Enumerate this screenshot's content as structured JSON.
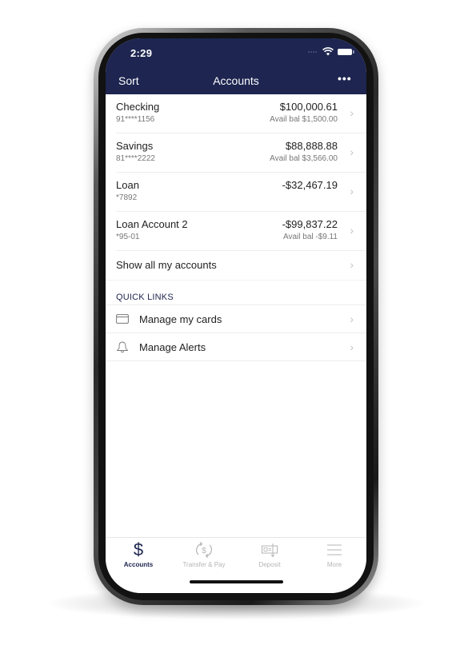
{
  "status_bar": {
    "time": "2:29"
  },
  "nav": {
    "left_label": "Sort",
    "title": "Accounts",
    "more_label": "•••"
  },
  "accounts": [
    {
      "name": "Checking",
      "number": "91****1156",
      "balance": "$100,000.61",
      "avail": "Avail bal $1,500.00"
    },
    {
      "name": "Savings",
      "number": "81****2222",
      "balance": "$88,888.88",
      "avail": "Avail bal $3,566.00"
    },
    {
      "name": "Loan",
      "number": "*7892",
      "balance": "-$32,467.19",
      "avail": ""
    },
    {
      "name": "Loan Account 2",
      "number": "*95-01",
      "balance": "-$99,837.22",
      "avail": "Avail bal -$9.11"
    }
  ],
  "show_all_label": "Show all my accounts",
  "chevron": "›",
  "quick_links": {
    "header": "QUICK LINKS",
    "items": [
      {
        "label": "Manage my cards",
        "icon": "credit-card-icon"
      },
      {
        "label": "Manage Alerts",
        "icon": "bell-icon"
      }
    ]
  },
  "tab_bar": {
    "tabs": [
      {
        "label": "Accounts",
        "icon": "dollar-icon",
        "active": true
      },
      {
        "label": "Transfer & Pay",
        "icon": "transfer-pay-icon",
        "active": false
      },
      {
        "label": "Deposit",
        "icon": "deposit-check-icon",
        "active": false
      },
      {
        "label": "More",
        "icon": "hamburger-menu-icon",
        "active": false
      }
    ],
    "dollar_glyph": "$"
  },
  "colors": {
    "brand_navy": "#1d2550",
    "inactive_tab": "#b5b5b5",
    "chevron": "#c4c4c4"
  }
}
